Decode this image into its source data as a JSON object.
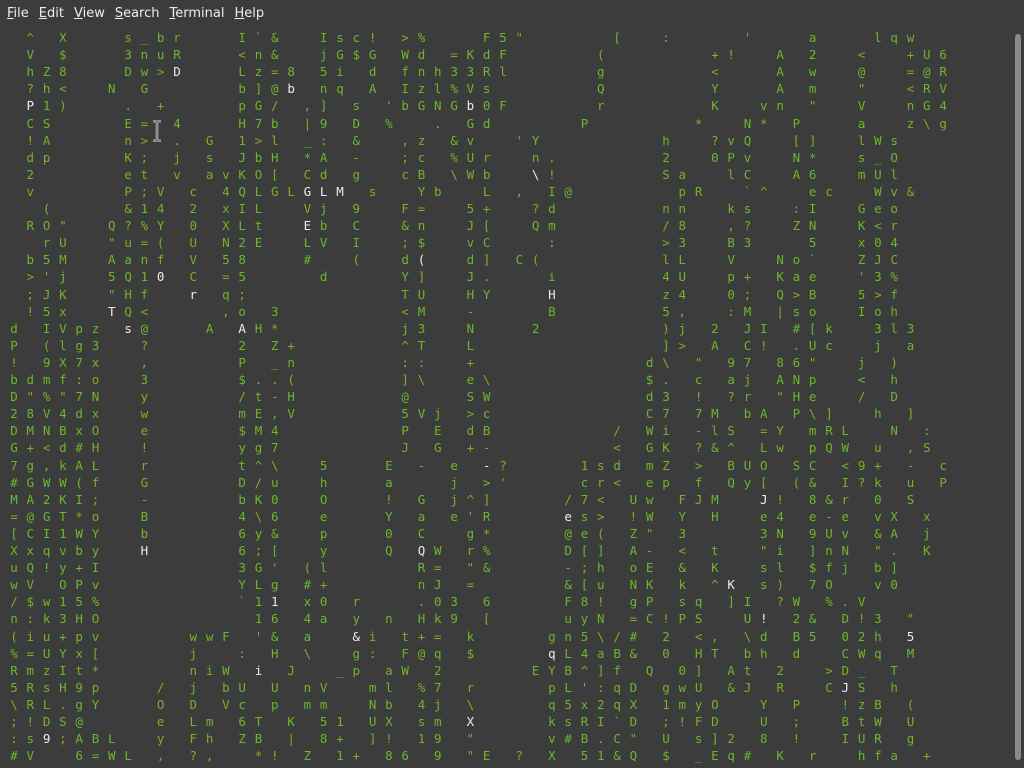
{
  "menubar": {
    "items": [
      {
        "name": "file",
        "underline": "F",
        "rest": "ile"
      },
      {
        "name": "edit",
        "underline": "E",
        "rest": "dit"
      },
      {
        "name": "view",
        "underline": "V",
        "rest": "iew"
      },
      {
        "name": "search",
        "underline": "S",
        "rest": "earch"
      },
      {
        "name": "terminal",
        "underline": "T",
        "rest": "erminal"
      },
      {
        "name": "help",
        "underline": "H",
        "rest": "elp"
      }
    ]
  },
  "terminal": {
    "colors": {
      "background": "#3c3c3c",
      "green": "#6fb52c",
      "white": "#ececec"
    },
    "rain": [
      "  ^   X       s _ b r       I ` &     I s c !   > %       F 5 \"           [     :         '       a       l q w",
      "  V   $       3 n u R       < n &     j G $ G   W d   = K d F           (             + !     A   2     <     + U 6",
      "  h Z 8       D w > L       L z = 8   5 i   d   f n h 3 3 R l           g             <       A   w     @     = @ R",
      "  ? h <     N   G           b ] @ b   n q   A   I z l % V s             Q             Y       A   m     \"     < R V",
      "  P 1 )       .   +         p G /   , ]   s   ' b G N G ^ 0 F           r             K     v n   \"     V     n G 4",
      "  C S         E =   4       H 7 b   | 9   D   %     .   G d           P             *     N *   P       a     z \\ g",
      "  ! A         n >   .   G   1 > l   _ :   &     , z   & v     ' Y               h     ? v Q     [ ]     l W s",
      "  d p         K ;   j   s   J b H   * A   -     ; c   % U r     n .             2     0 P v     N *     s _ O",
      "  2           e t   v   a v K O [   C d   g     c B   \\ W b     a !             S a     l C     A 6     m U l",
      "  v           P ; V   c   4 Q L G L M 3 G   s     Y b     L   ,   I @             p R     ` ^     e c     W v &",
      "    (         & 1 4   2   x I L     V j   9     F =     5 +     ? d             n n     k s     : I     G e o",
      "  R O \"     Q ? % Y   0   X L t     1 b   C     & n     J [     Q m             / 8     , ?     Z N     K < r",
      "    r U     \" u = (   U   N 2 E     L V   I     ; $     v C       :             > 3     B 3       5     x 0 4",
      "  b 5 M     A a n f   V   5 8       #     (     d 6     d ]   C (               l L     V     N o `     Z J C",
      "  > ' j     5 Q 1 0   C   = 5         d         Y ]     J .       i             4 U     p +   K a e     ' 3 %",
      "  ; J K     \" H f     r   q ;                   T U     H Y       v             z 4     0 ;   Q > B     5 > f",
      "  ! 5 x     T Q <         , o   3               < M     -         B             5 ,     : M   | s o     I o h",
      "d   I V p z   s @       A   1 H *               j 3     N       2               ) j   2   J I   # [ k     3 l 3",
      "P   ( l g 3     ?           2   Z +             ^ T     L                       ] >   A   C !   . U c     j   a",
      "!   9 X 7 x     ,           P   _ n             : :     +                     d \\   \"   9 7   8 6 \"     j   )",
      "b d m f : o     3           $ . . (             ] \\     e \\                   $ .   c   a j   A N p     <   h",
      "D \" % \" 7 N     y           / t - H             @       S W                   d 3   !   ? r   \" H e     /   D",
      "2 8 V 4 d x     w           m E , V             5 V j   > c                   C 7   7 M   b A   P \\ ]     h   ]",
      "D M N B x O     e           $ M 4               P   E   d B               /   W i   - l S   = Y   m R L     N   :",
      "G + < d # H     !           y g 7               J   G   + -               <   G K   ? & ^   L w   p Q W   u   , S",
      "7 g , k A L     r           t ^ \\     5       E   -   e   ] ?         1 s d   m Z   >   B U O   S C   < 9 +   -   c",
      "# G W W ( f     G           D / u     h       a       j   > '         c r <   e p   f   Q y [   ( &   I ? k   u   P",
      "M A 2 K I ;     -           b K 0     O       !   G   j ^ ]         / 7 <   U w   F J M     ! !   8 & r   0   S",
      "= @ G T * o     B           4 \\ 6     e       Y   a   e ' R         5 s >   ! W   Y   H     e 4   e - e   v X   x",
      "[ C I 1 W Y     b           6 y &     p       0   C     g *         @ e (   Z \"   3         3 N   9 U v   & A   j",
      "X x q v b y     H           6 ; [     y       Q   + W   r %         D [ ]   A -   <   t     \" i   ] n N   \" .   K",
      "u Q ! y + I                 3 G '   ( l           R =   \" &         - ; h   o E   &   K     s l   $ f j   b ]",
      "w V   O P v                 Y L g   # +           n J   =           & [ u   N K   k   ^ $   s )   7 O     v 0",
      "/ $ w 1 5 %                 ` 1 P   x 0   r       . 0 3   6         F 8 !   g P   s q   ] I   ? W   % . V",
      "n : k 3 H O                   1 6   4 a   y   n   H k 9   [         u y N   = C ! P S     U E   2 &   D ! 3   \"",
      "( i u + p v           w w F   ' &   a     # i   t + =   k         g n 5 \\ / #   2   < ,   \\ d   B 5   0 2 h   B",
      "% = U Y x [           j     :   H   \\     g :   F @ q   $         R L 4 a B &   0   H T   b h   d     C W q   M",
      "R m z I t *           n i W   \"   J     _ p   a W   2           E Y B ^ ] f   Q   0 ]   A t   2     > D _   T",
      "5 R s H 9 p       /   j   b U   U   n V     m l   % 7   r         p L ' : q D   g w U   & J   R     C P S   h",
      "\\ R L . g Y       O   D   V c   p   m m     N b   4 j   \\         q 5 x 2 q X   1 m y O     Y   P     ! z B   (",
      "; ! D S @         e   L m   6 T   K   5 1   U X   s m   \"         k s R I ` D   ; ! F D     U   ;     B t W   U",
      ": s 9 ; A B L     y   F h   Z B   |   8 +   ] !   1 9   \"         v # B . C \"   U   s ] 2   8   !     I U R   g",
      "# V     6 = W L   ,   ? ,     * !   Z   1 +   8 6   9   \" E   ?   X   5 1 & Q   $   _ E q #   K   r     h f a   +"
    ],
    "white_glyphs": [
      {
        "row": 2,
        "col": 10,
        "char": "D"
      },
      {
        "row": 2,
        "col": 11,
        "char": "w"
      },
      {
        "row": 2,
        "col": 12,
        "char": ">"
      },
      {
        "row": 2,
        "col": 13,
        "char": "L"
      },
      {
        "row": 3,
        "col": 17,
        "char": "b"
      },
      {
        "row": 4,
        "col": 1,
        "char": "P"
      },
      {
        "row": 4,
        "col": 28,
        "char": "b"
      },
      {
        "row": 4,
        "col": 32,
        "char": "G"
      },
      {
        "row": 5,
        "col": 27,
        "char": "%"
      },
      {
        "row": 5,
        "col": 53,
        "char": "P"
      },
      {
        "row": 7,
        "col": 3,
        "char": "p"
      },
      {
        "row": 7,
        "col": 50,
        "char": "0"
      },
      {
        "row": 8,
        "col": 32,
        "char": "\\"
      },
      {
        "row": 9,
        "col": 18,
        "char": "G"
      },
      {
        "row": 9,
        "col": 19,
        "char": "L"
      },
      {
        "row": 9,
        "col": 20,
        "char": "M"
      },
      {
        "row": 11,
        "col": 18,
        "char": "E"
      },
      {
        "row": 12,
        "col": 23,
        "char": "V"
      },
      {
        "row": 13,
        "col": 25,
        "char": "("
      },
      {
        "row": 13,
        "col": 37,
        "char": "C"
      },
      {
        "row": 14,
        "col": 9,
        "char": "0"
      },
      {
        "row": 14,
        "col": 22,
        "char": "d"
      },
      {
        "row": 15,
        "col": 11,
        "char": "r"
      },
      {
        "row": 15,
        "col": 33,
        "char": "H"
      },
      {
        "row": 16,
        "col": 6,
        "char": "T"
      },
      {
        "row": 17,
        "col": 7,
        "char": "s"
      },
      {
        "row": 17,
        "col": 14,
        "char": "A"
      },
      {
        "row": 17,
        "col": 38,
        "char": "2"
      },
      {
        "row": 17,
        "col": 61,
        "char": "l"
      },
      {
        "row": 22,
        "col": 18,
        "char": "V"
      },
      {
        "row": 22,
        "col": 30,
        "char": "V"
      },
      {
        "row": 24,
        "col": 60,
        "char": ","
      },
      {
        "row": 25,
        "col": 29,
        "char": "-"
      },
      {
        "row": 27,
        "col": 46,
        "char": "J"
      },
      {
        "row": 28,
        "col": 34,
        "char": "e"
      },
      {
        "row": 30,
        "col": 8,
        "char": "H"
      },
      {
        "row": 30,
        "col": 25,
        "char": "Q"
      },
      {
        "row": 30,
        "col": 62,
        "char": "K"
      },
      {
        "row": 31,
        "col": 56,
        "char": "j"
      },
      {
        "row": 32,
        "col": 44,
        "char": "K"
      },
      {
        "row": 33,
        "col": 16,
        "char": "1"
      },
      {
        "row": 34,
        "col": 46,
        "char": "!"
      },
      {
        "row": 35,
        "col": 21,
        "char": "&"
      },
      {
        "row": 35,
        "col": 55,
        "char": "5"
      },
      {
        "row": 36,
        "col": 33,
        "char": "q"
      },
      {
        "row": 37,
        "col": 15,
        "char": "i"
      },
      {
        "row": 38,
        "col": 51,
        "char": "J"
      },
      {
        "row": 40,
        "col": 28,
        "char": "X"
      },
      {
        "row": 41,
        "col": 2,
        "char": "9"
      },
      {
        "row": 41,
        "col": 39,
        "char": "#"
      }
    ]
  }
}
